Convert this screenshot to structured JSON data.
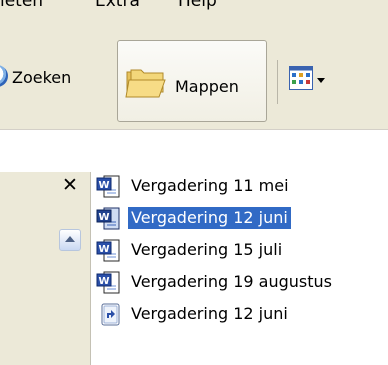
{
  "menu": {
    "items": [
      "ieten",
      "Extra",
      "Help"
    ]
  },
  "toolbar": {
    "search_label": "Zoeken",
    "folders_label": "Mappen"
  },
  "files": [
    {
      "name": "Vergadering 11 mei",
      "icon": "word-document-icon",
      "selected": false
    },
    {
      "name": "Vergadering 12 juni",
      "icon": "word-document-icon",
      "selected": true
    },
    {
      "name": "Vergadering 15 juli",
      "icon": "word-document-icon",
      "selected": false
    },
    {
      "name": "Vergadering 19 augustus",
      "icon": "word-document-icon",
      "selected": false
    },
    {
      "name": "Vergadering 12 juni",
      "icon": "shortcut-icon",
      "selected": false
    }
  ],
  "colors": {
    "chrome": "#ece9d8",
    "selection": "#316ac5"
  }
}
